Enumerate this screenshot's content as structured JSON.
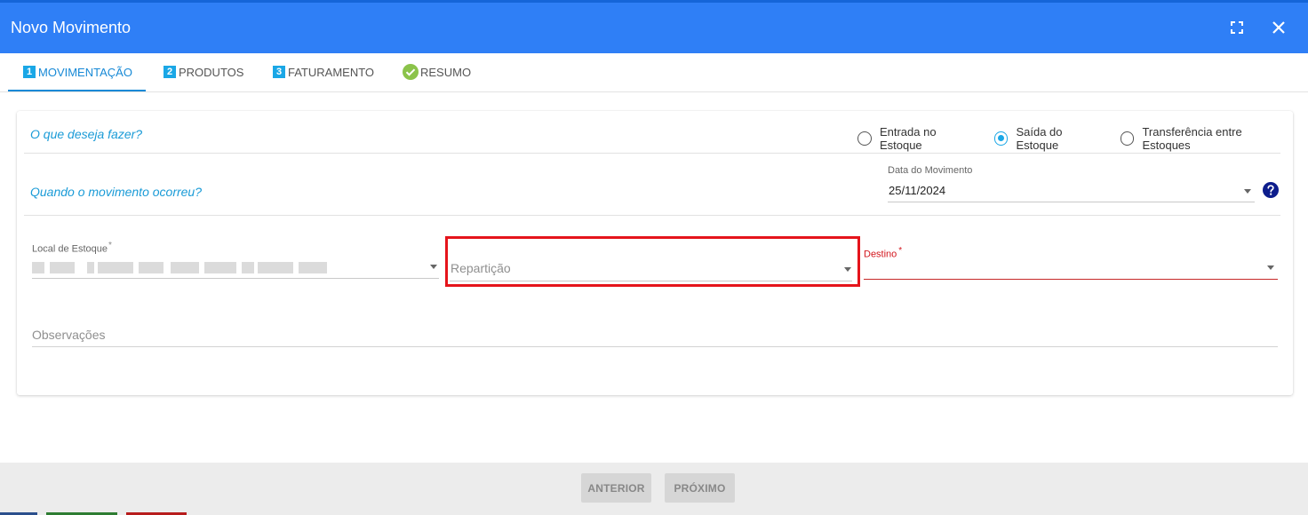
{
  "window": {
    "title": "Novo Movimento",
    "maximize_icon": "maximize-icon",
    "close_icon": "close-icon",
    "accent_color": "#2f7ff6"
  },
  "tabs": [
    {
      "number": "1",
      "label": "MOVIMENTAÇÃO",
      "active": true
    },
    {
      "number": "2",
      "label": "PRODUTOS",
      "active": false
    },
    {
      "number": "3",
      "label": "FATURAMENTO",
      "active": false
    },
    {
      "icon": "check-circle-icon",
      "label": "RESUMO",
      "active": false
    }
  ],
  "form": {
    "question_action": "O que deseja fazer?",
    "question_when": "Quando o movimento ocorreu?",
    "movement_types": [
      {
        "label": "Entrada no Estoque",
        "selected": false
      },
      {
        "label": "Saída do Estoque",
        "selected": true
      },
      {
        "label": "Transferência entre Estoques",
        "selected": false
      }
    ],
    "date": {
      "label": "Data do Movimento",
      "value": "25/11/2024"
    },
    "local_estoque": {
      "label": "Local de Estoque",
      "required_mark": "*",
      "value_redacted": true
    },
    "reparticao": {
      "placeholder": "Repartição",
      "highlight_color": "#e5141b"
    },
    "destino": {
      "label": "Destino",
      "required_mark": "*",
      "error_color": "#d3161d"
    },
    "observacoes": {
      "placeholder": "Observações"
    }
  },
  "footer": {
    "prev_label": "ANTERIOR",
    "next_label": "PRÓXIMO"
  }
}
